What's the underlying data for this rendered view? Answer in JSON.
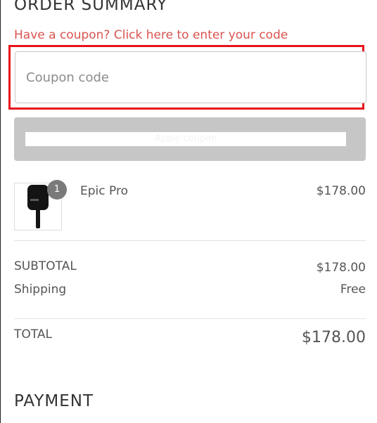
{
  "order_summary": {
    "title": "ORDER SUMMARY",
    "coupon_prompt": "Have a coupon? Click here to enter your code",
    "coupon_input": {
      "placeholder": "Coupon code",
      "value": ""
    },
    "apply_button_label": "Apply coupon"
  },
  "line_items": [
    {
      "name": "Epic Pro",
      "quantity": "1",
      "price": "$178.00",
      "thumbnail_icon": "paddle-icon"
    }
  ],
  "totals": {
    "subtotal_label": "SUBTOTAL",
    "subtotal_value": "$178.00",
    "shipping_label": "Shipping",
    "shipping_value": "Free",
    "total_label": "TOTAL",
    "total_value": "$178.00"
  },
  "payment": {
    "title": "PAYMENT"
  },
  "colors": {
    "accent_link": "#d9534f",
    "highlight_border": "#e8141b",
    "button_disabled": "#c6c6c6",
    "badge": "#7a7a7a"
  }
}
